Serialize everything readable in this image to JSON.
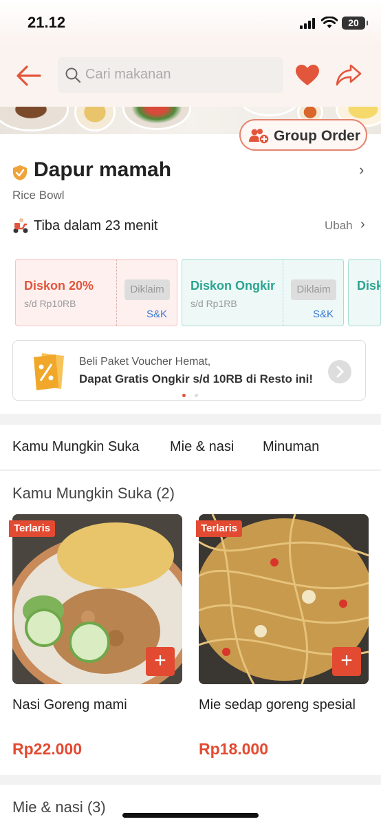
{
  "status_bar": {
    "time": "21.12",
    "battery": "20"
  },
  "header": {
    "search_placeholder": "Cari makanan"
  },
  "group_order_label": "Group Order",
  "restaurant": {
    "name": "Dapur mamah",
    "category": "Rice Bowl",
    "eta": "Tiba dalam 23 menit",
    "change_label": "Ubah"
  },
  "vouchers": [
    {
      "title": "Diskon 20%",
      "sub": "s/d Rp10RB",
      "claim": "Diklaim",
      "terms": "S&K"
    },
    {
      "title": "Diskon Ongkir",
      "sub": "s/d Rp1RB",
      "claim": "Diklaim",
      "terms": "S&K"
    },
    {
      "title": "Disk"
    }
  ],
  "voucher_package": {
    "line1": "Beli Paket Voucher Hemat,",
    "line2": "Dapat Gratis Ongkir s/d 10RB di Resto ini!"
  },
  "tabs": [
    "Kamu Mungkin Suka",
    "Mie & nasi",
    "Minuman"
  ],
  "sections": [
    {
      "title": "Kamu Mungkin Suka (2)"
    },
    {
      "title": "Mie & nasi (3)"
    }
  ],
  "items": [
    {
      "badge": "Terlaris",
      "name": "Nasi Goreng mami",
      "price": "Rp22.000",
      "add": "+"
    },
    {
      "badge": "Terlaris",
      "name": "Mie sedap goreng spesial",
      "price": "Rp18.000",
      "add": "+"
    }
  ],
  "colors": {
    "accent": "#e24a31",
    "teal": "#2aa591",
    "header_bg": "#fbf3ef"
  }
}
